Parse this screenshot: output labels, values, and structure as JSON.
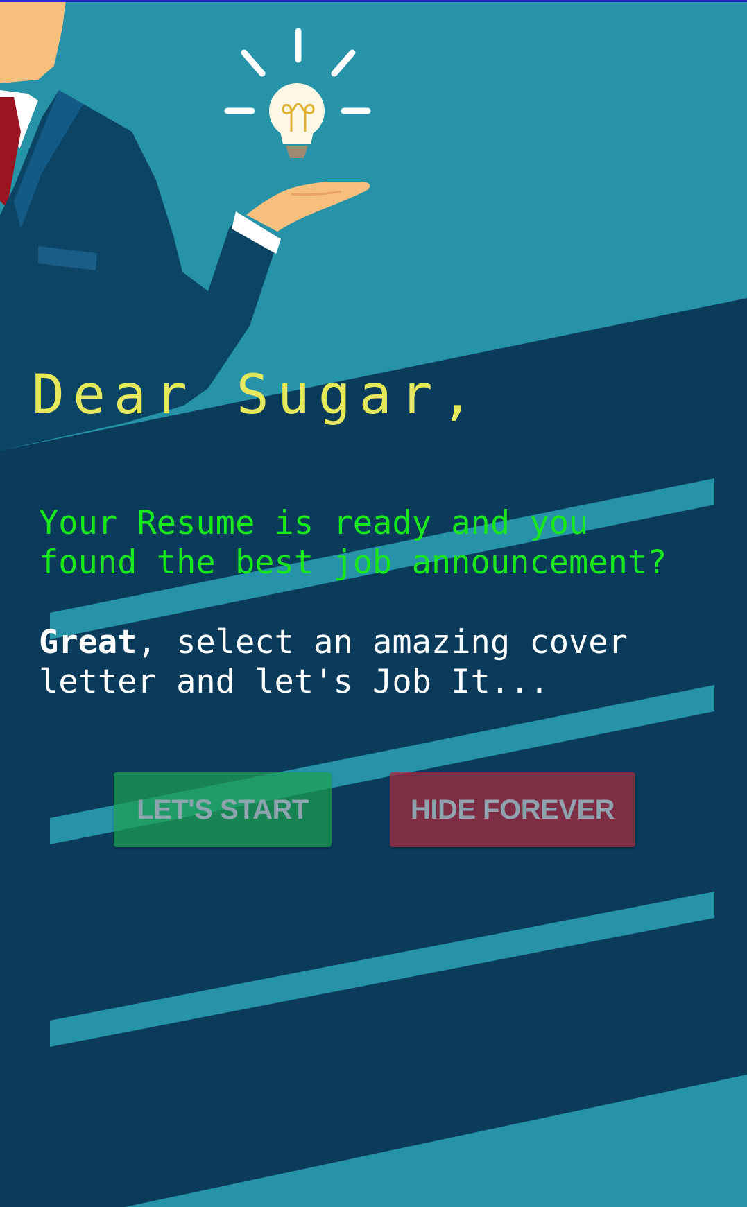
{
  "greeting": "Dear Sugar,",
  "question": "Your Resume is ready and you found the best job announcement?",
  "cta": {
    "bold": "Great",
    "rest": ", select an amazing cover letter and let's Job It..."
  },
  "buttons": {
    "start": "LET'S START",
    "hide": "HIDE FOREVER"
  },
  "colors": {
    "background_dark": "#0a3b5a",
    "background_teal": "#2693a8",
    "greeting": "#e5e85a",
    "question": "#18e81c",
    "cta_text": "#ffffff",
    "start_button": "#1e9f50",
    "hide_button": "#aa283c"
  },
  "illustration": {
    "icons": [
      "businessman-illustration",
      "lightbulb-icon"
    ]
  }
}
